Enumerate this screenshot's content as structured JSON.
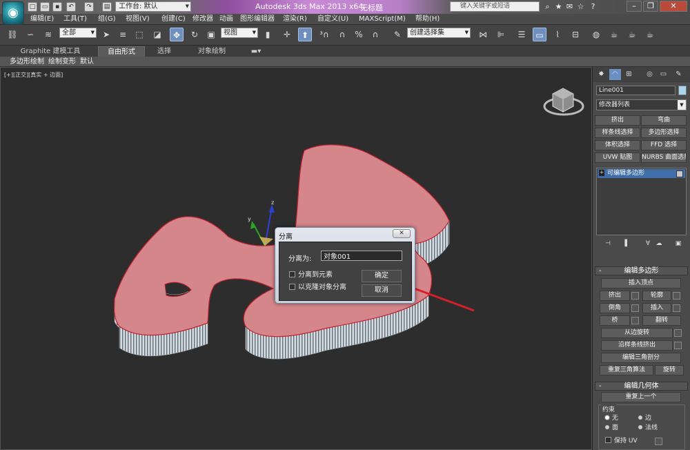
{
  "titlebar": {
    "workspace": "工作台: 默认",
    "app_title": "Autodesk 3ds Max  2013 x64",
    "doc_title": "无标题",
    "search_placeholder": "键入关键字或短语"
  },
  "menus": [
    "编辑(E)",
    "工具(T)",
    "组(G)",
    "视图(V)",
    "创建(C)",
    "修改器",
    "动画",
    "图形编辑器",
    "渲染(R)",
    "自定义(U)",
    "MAXScript(M)",
    "帮助(H)"
  ],
  "toolbar": {
    "selection_filter": "全部",
    "ref_coord": "视图",
    "named_selection": "创建选择集"
  },
  "ribbon": {
    "tabs": [
      "Graphite 建模工具",
      "自由形式",
      "选择",
      "对象绘制"
    ],
    "subtabs": [
      "多边形绘制",
      "绘制变形",
      "默认"
    ]
  },
  "viewport": {
    "label": "[+][正交][真实 + 边面]"
  },
  "dialog": {
    "title": "分离",
    "close": "✕",
    "label": "分离为:",
    "value": "对象001",
    "option1": "分离到元素",
    "option2": "以克隆对象分离",
    "ok": "确定",
    "cancel": "取消"
  },
  "command_panel": {
    "object_name": "Line001",
    "modifier_list": "修改器列表",
    "mod_buttons": [
      "挤出",
      "弯曲",
      "样条线选择",
      "多边形选择",
      "体积选择",
      "FFD 选择",
      "UVW 贴图",
      "NURBS 曲面选择"
    ],
    "stack_item": "可编辑多边形",
    "edit_poly": {
      "title": "编辑多边形",
      "insert_vertex": "插入顶点",
      "extrude": "挤出",
      "outline": "轮廓",
      "bevel": "倒角",
      "inset": "插入",
      "bridge": "桥",
      "flip": "翻转",
      "hinge": "从边旋转",
      "extrude_spline": "沿样条线挤出",
      "edit_tri": "编辑三角剖分",
      "retri": "重复三角算法",
      "turn": "旋转"
    },
    "edit_geom": {
      "title": "编辑几何体",
      "repeat_last": "重复上一个",
      "constraints": "约束",
      "none": "无",
      "edge": "边",
      "face": "面",
      "normal": "法线",
      "preserve_uv": "保持 UV"
    }
  },
  "colors": {
    "shape_fill": "#d4868a",
    "shape_edge": "#c02030",
    "accent": "#3f6ea8"
  }
}
